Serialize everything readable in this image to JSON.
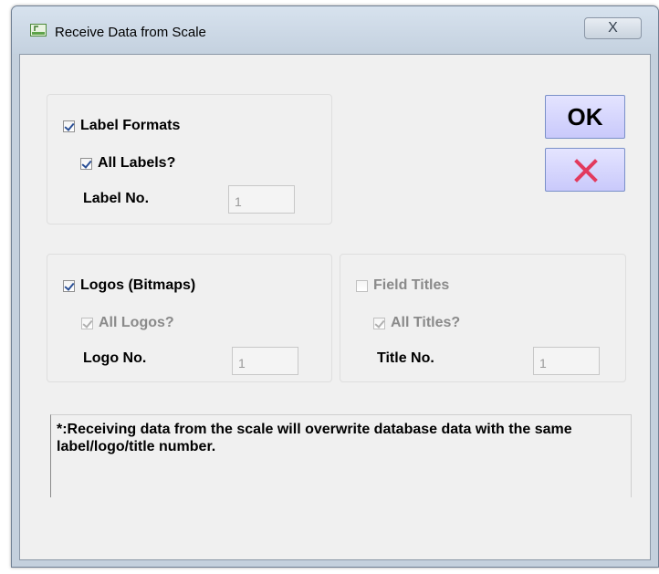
{
  "window": {
    "title": "Receive Data from Scale",
    "close_label": "X"
  },
  "labels_group": {
    "label_formats": {
      "label": "Label Formats",
      "checked": true
    },
    "all_labels": {
      "label": "All Labels?",
      "checked": true
    },
    "label_no": {
      "label": "Label No.",
      "value": "1"
    }
  },
  "logos_group": {
    "logos": {
      "label": "Logos (Bitmaps)",
      "checked": true
    },
    "all_logos": {
      "label": "All Logos?",
      "checked": true,
      "disabled": true
    },
    "logo_no": {
      "label": "Logo No.",
      "value": "1"
    }
  },
  "titles_group": {
    "field_titles": {
      "label": "Field Titles",
      "checked": false,
      "disabled": true
    },
    "all_titles": {
      "label": "All Titles?",
      "checked": true,
      "disabled": true
    },
    "title_no": {
      "label": "Title No.",
      "value": "1"
    }
  },
  "buttons": {
    "ok_label": "OK",
    "cancel_icon": "red-x-icon"
  },
  "note": "*:Receiving data from the scale will overwrite database data with the same label/logo/title number.",
  "colors": {
    "button_fill": "#d6d6fd",
    "cancel_x": "#e23a5e",
    "client_bg": "#f0f0f0",
    "frame": "#c4d0dd"
  }
}
